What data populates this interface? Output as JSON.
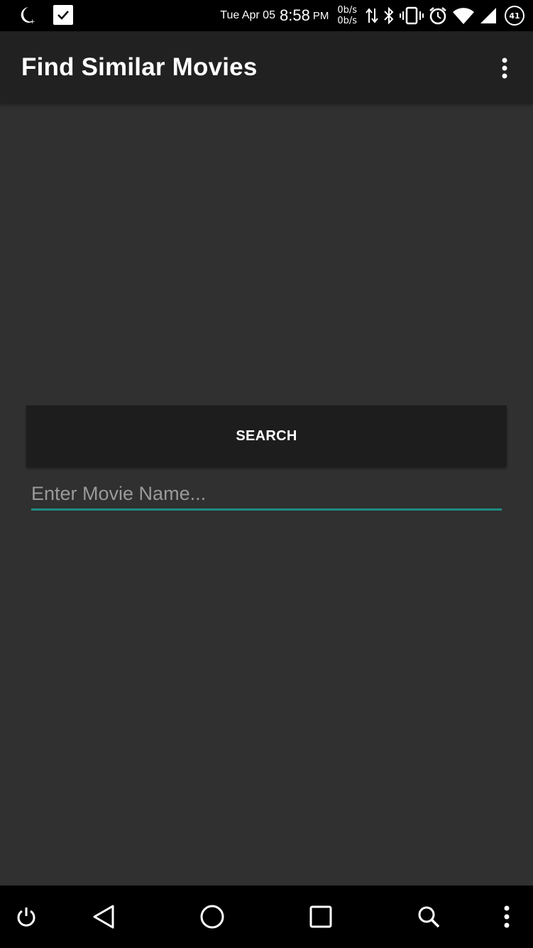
{
  "status_bar": {
    "date": "Tue Apr 05",
    "time": "8:58",
    "ampm": "PM",
    "speed_up": "0b/s",
    "speed_down": "0b/s",
    "battery": "41",
    "icons": [
      "moon-icon",
      "checkbox-icon",
      "data-transfer-icon",
      "bluetooth-icon",
      "vibrate-icon",
      "alarm-icon",
      "wifi-icon",
      "signal-icon",
      "battery-icon"
    ]
  },
  "app_bar": {
    "title": "Find Similar Movies",
    "overflow_icon": "more-vert-icon"
  },
  "main": {
    "search_button_label": "SEARCH",
    "movie_input": {
      "placeholder": "Enter Movie Name...",
      "value": ""
    }
  },
  "nav_bar": {
    "icons": [
      "power-icon",
      "back-icon",
      "home-icon",
      "recents-icon",
      "search-icon",
      "more-vert-icon"
    ]
  },
  "colors": {
    "background": "#303030",
    "app_bar": "#212121",
    "button": "#1d1d1d",
    "accent": "#1e8e83"
  }
}
